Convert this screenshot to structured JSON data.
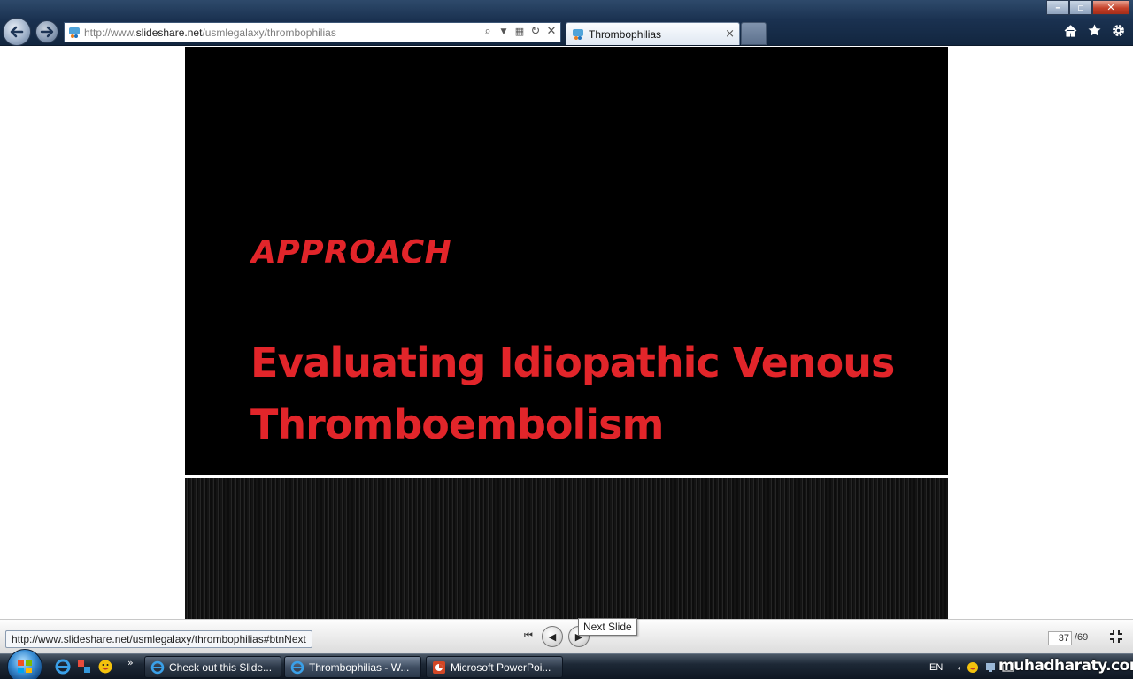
{
  "browser": {
    "url_prefix": "http://www.",
    "url_domain": "slideshare.net",
    "url_path": "/usmlegalaxy/thrombophilias",
    "tab_title": "Thrombophilias",
    "tab_close": "×",
    "window_controls": {
      "minimize": "–",
      "maximize": "▫",
      "close": "✕"
    }
  },
  "slide": {
    "heading": "APPROACH",
    "title": "Evaluating Idiopathic Venous Thromboembolism"
  },
  "player": {
    "status_url": "http://www.slideshare.net/usmlegalaxy/thrombophilias#btnNext",
    "tooltip": "Next Slide",
    "current_page": "37",
    "total_pages": "/69"
  },
  "taskbar": {
    "tasks": [
      {
        "label": "Check out this Slide..."
      },
      {
        "label": "Thrombophilias - W..."
      },
      {
        "label": "Microsoft PowerPoi..."
      }
    ],
    "tray_lang": "EN",
    "quicklaunch_more": "»"
  },
  "watermark": "muhadharaty.com",
  "colors": {
    "slide_text": "#e2252a",
    "slide_bg": "#000000",
    "chrome_dark": "#1a3150"
  }
}
